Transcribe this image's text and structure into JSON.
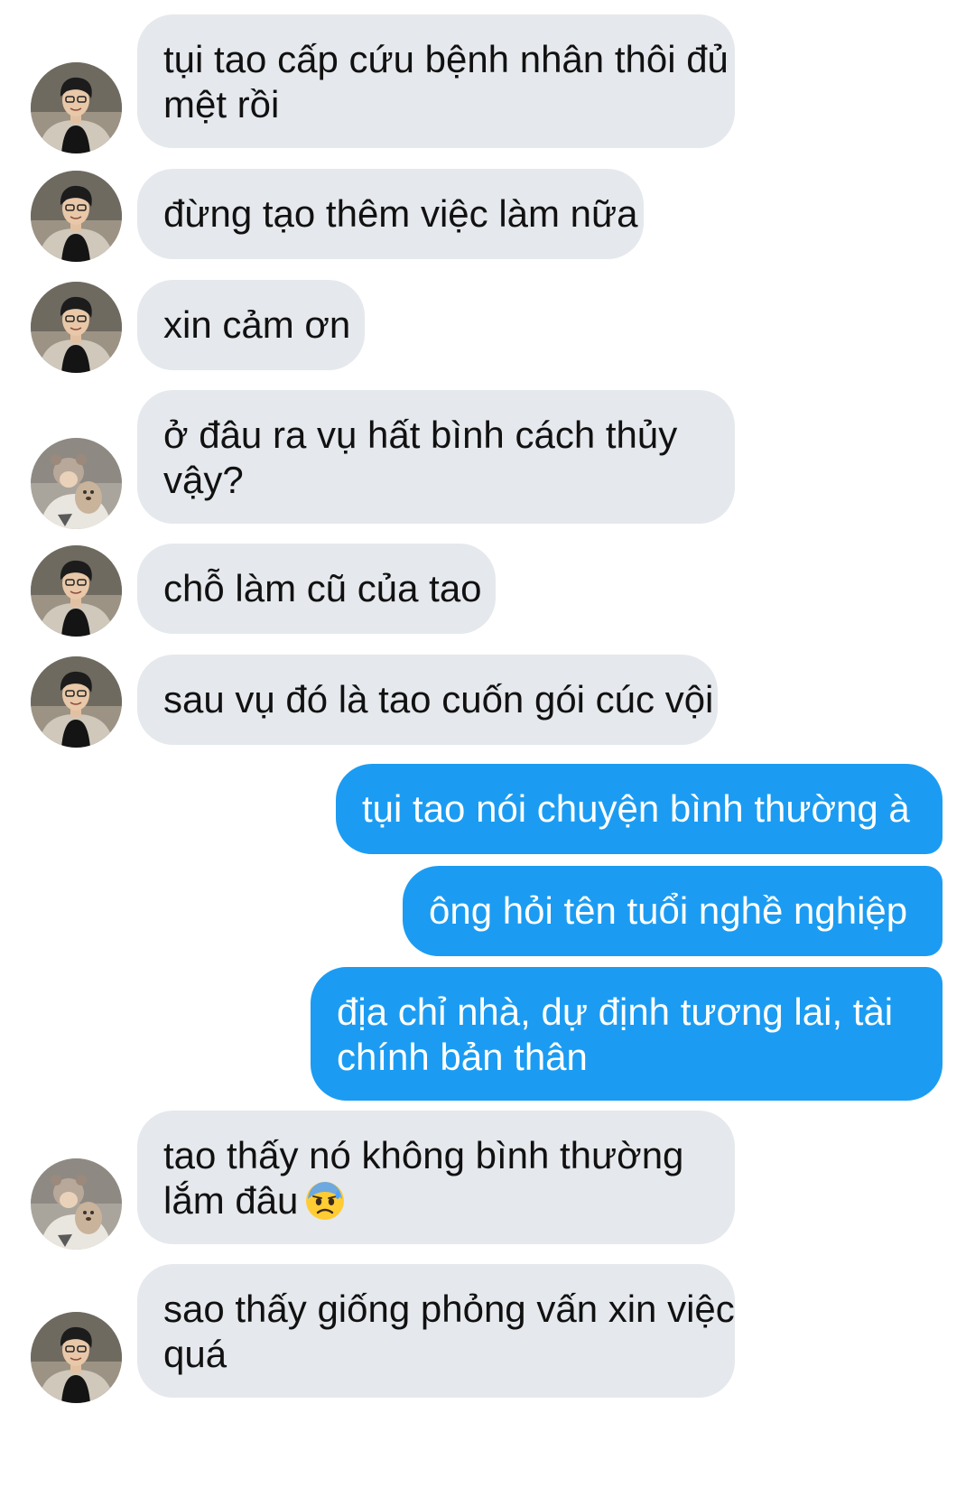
{
  "messages": [
    {
      "sender": "friend-a",
      "lines": [
        "tụi tao cấp cứu bệnh nhân thôi đủ",
        "mệt rồi"
      ]
    },
    {
      "sender": "friend-a",
      "lines": [
        "đừng tạo thêm việc làm nữa"
      ]
    },
    {
      "sender": "friend-a",
      "lines": [
        "xin cảm ơn"
      ]
    },
    {
      "sender": "friend-b",
      "lines": [
        "ở đâu ra vụ hất bình cách thủy",
        "vậy?"
      ]
    },
    {
      "sender": "friend-a",
      "lines": [
        "chỗ làm cũ của tao"
      ]
    },
    {
      "sender": "friend-a",
      "lines": [
        "sau vụ đó là tao cuốn gói cúc vội"
      ]
    },
    {
      "sender": "me",
      "lines": [
        "tụi tao nói chuyện bình thường à"
      ]
    },
    {
      "sender": "me",
      "lines": [
        "ông hỏi tên tuổi nghề nghiệp"
      ]
    },
    {
      "sender": "me",
      "lines": [
        "địa chỉ nhà, dự định tương lai, tài",
        "chính bản thân"
      ]
    },
    {
      "sender": "friend-b",
      "lines": [
        "tao thấy nó không bình thường",
        "lắm đâu"
      ],
      "emoji": "anxious-sweat-face"
    },
    {
      "sender": "friend-a",
      "lines": [
        "sao thấy giống phỏng vấn xin việc",
        "quá"
      ]
    }
  ],
  "colors": {
    "incoming_bubble": "#e5e8ec",
    "outgoing_bubble": "#1b9cf2",
    "incoming_text": "#111111",
    "outgoing_text": "#ffffff"
  }
}
